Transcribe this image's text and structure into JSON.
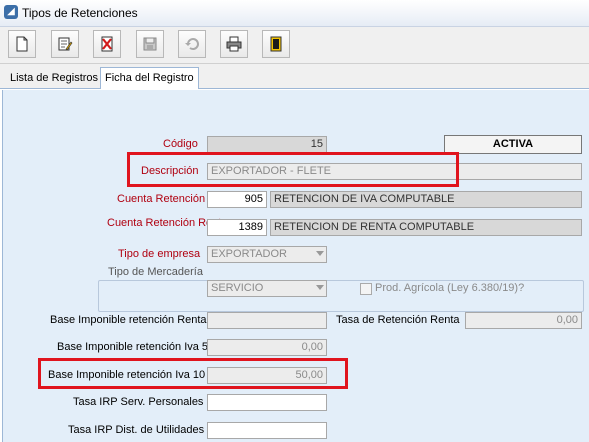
{
  "window": {
    "title": "Tipos de Retenciones"
  },
  "toolbar": {
    "buttons": [
      {
        "icon": "new-document-icon"
      },
      {
        "icon": "edit-icon"
      },
      {
        "icon": "delete-icon"
      },
      {
        "icon": "save-icon"
      },
      {
        "icon": "undo-icon"
      },
      {
        "icon": "print-icon"
      },
      {
        "icon": "exit-icon"
      }
    ]
  },
  "tabs": [
    {
      "label": "Lista de Registros",
      "active": false
    },
    {
      "label": "Ficha del Registro",
      "active": true
    }
  ],
  "form": {
    "codigo": {
      "label": "Código",
      "value": "15"
    },
    "status": "ACTIVA",
    "descripcion": {
      "label": "Descripción",
      "value": "EXPORTADOR - FLETE"
    },
    "cuenta_iva": {
      "label": "Cuenta Retención IVA",
      "code": "905",
      "name": "RETENCION DE IVA COMPUTABLE"
    },
    "cuenta_renta": {
      "label": "Cuenta Retención Renta",
      "code": "1389",
      "name": "RETENCION DE RENTA COMPUTABLE"
    },
    "tipo_empresa": {
      "label": "Tipo de empresa",
      "value": "EXPORTADOR"
    },
    "tipo_mercaderia": {
      "label": "Tipo de Mercadería",
      "value": "SERVICIO",
      "checkbox_label": "Prod. Agrícola (Ley 6.380/19)?",
      "checked": false
    },
    "base_renta": {
      "label": "Base Imponible retención Renta",
      "value": ""
    },
    "tasa_renta": {
      "label": "Tasa de Retención Renta",
      "value": "0,00"
    },
    "base_iva5": {
      "label": "Base Imponible retención Iva 5",
      "value": "0,00"
    },
    "base_iva10": {
      "label": "Base Imponible retención Iva 10",
      "value": "50,00"
    },
    "tasa_irp_serv": {
      "label": "Tasa IRP Serv. Personales",
      "value": ""
    },
    "tasa_irp_dist": {
      "label": "Tasa IRP Dist. de Utilidades",
      "value": ""
    }
  },
  "colors": {
    "highlight": "#e0141e",
    "panel": "#e3eef9",
    "label_red": "#b00010"
  }
}
